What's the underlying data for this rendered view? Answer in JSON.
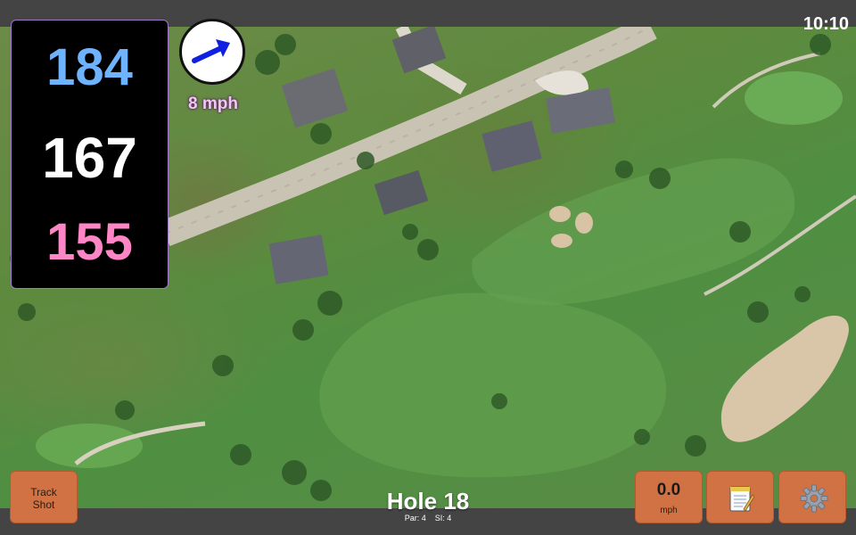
{
  "status_bar": {
    "time": "10:10"
  },
  "yardage": {
    "back": "184",
    "middle": "167",
    "front": "155"
  },
  "wind": {
    "speed": "8 mph",
    "icon": "wind-arrow-icon"
  },
  "hole": {
    "title": "Hole 18",
    "par": "Par: 4",
    "stroke_index": "SI: 4"
  },
  "buttons": {
    "track_shot_line1": "Track",
    "track_shot_line2": "Shot",
    "speed_value": "0.0",
    "speed_unit": "mph",
    "notes_icon": "notepad-icon",
    "settings_icon": "gear-icon"
  },
  "colors": {
    "back": "#6fb3ff",
    "middle": "#ffffff",
    "front": "#ff86c6",
    "button": "#d17244",
    "wind_arrow": "#1020e0"
  }
}
